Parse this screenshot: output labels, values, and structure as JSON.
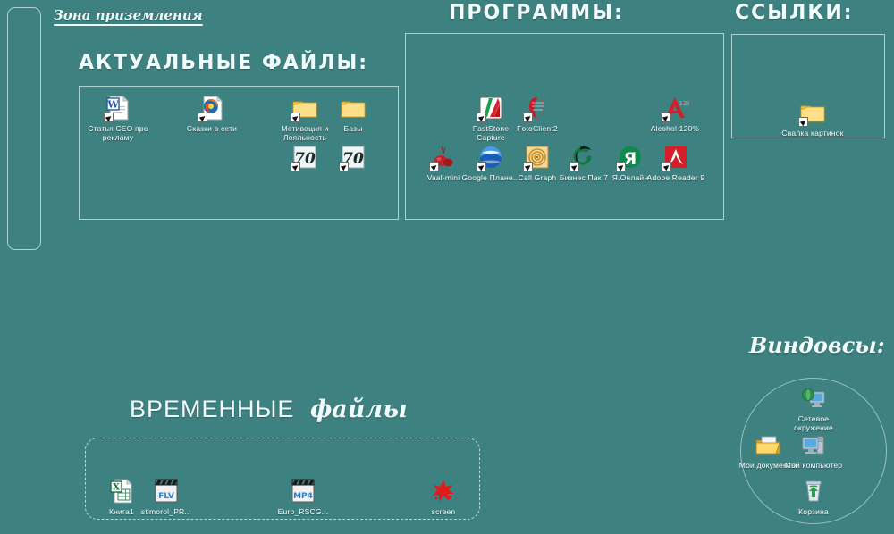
{
  "desktop": {
    "background_color": "#3d8180",
    "text_color": "#ffffff",
    "frame_color": "#deeeee"
  },
  "zones": {
    "landing": {
      "title": "Зона приземления"
    },
    "current_files": {
      "title": "АКТУАЛЬНЫЕ  ФАЙЛЫ:",
      "icons": [
        {
          "label": "Статья CEO про рекламу",
          "icon": "word-document-shortcut-icon"
        },
        {
          "label": "Сказки в сети",
          "icon": "firefox-html-document-shortcut-icon"
        },
        {
          "label": "Мотивация и Лояльность",
          "icon": "folder-shortcut-icon"
        },
        {
          "label": "Базы",
          "icon": "folder-icon"
        },
        {
          "label": "",
          "icon": "font-file-shortcut-icon"
        },
        {
          "label": "",
          "icon": "font-file-shortcut-icon"
        }
      ]
    },
    "programs": {
      "title": "ПРОГРАММЫ:",
      "icons": [
        {
          "label": "FastStone Capture",
          "icon": "faststone-capture-shortcut-icon"
        },
        {
          "label": "FotoClient2",
          "icon": "fotoclient2-shortcut-icon"
        },
        {
          "label": "Alcohol 120%",
          "icon": "alcohol-120-shortcut-icon"
        },
        {
          "label": "Vaal-mini",
          "icon": "vaal-mini-shortcut-icon"
        },
        {
          "label": "Google Плане...",
          "icon": "google-earth-shortcut-icon"
        },
        {
          "label": "Call Graph",
          "icon": "call-graph-shortcut-icon"
        },
        {
          "label": "Бизнес Пак 7",
          "icon": "business-pack-shortcut-icon"
        },
        {
          "label": "Я.Онлайн",
          "icon": "yandex-online-shortcut-icon"
        },
        {
          "label": "Adobe Reader 9",
          "icon": "adobe-reader-shortcut-icon"
        }
      ]
    },
    "links": {
      "title": "ССЫЛКИ:",
      "icons": [
        {
          "label": "Свалка картинок",
          "icon": "folder-shortcut-icon"
        }
      ]
    },
    "temp_files": {
      "title_caps": "ВРЕМЕННЫЕ",
      "title_cursive": "файлы",
      "icons": [
        {
          "label": "Книга1",
          "icon": "excel-document-icon"
        },
        {
          "label": "stimorol_PR...",
          "icon": "flv-video-file-icon"
        },
        {
          "label": "Euro_RSCG...",
          "icon": "mp4-video-file-icon"
        },
        {
          "label": "screen",
          "icon": "red-splat-image-icon"
        }
      ]
    },
    "windows": {
      "title": "Виндовсы:",
      "icons": [
        {
          "label": "Сетевое окружение",
          "icon": "network-neighborhood-icon"
        },
        {
          "label": "Мои документы",
          "icon": "my-documents-icon"
        },
        {
          "label": "Мой компьютер",
          "icon": "my-computer-icon"
        },
        {
          "label": "Корзина",
          "icon": "recycle-bin-icon"
        }
      ]
    }
  }
}
